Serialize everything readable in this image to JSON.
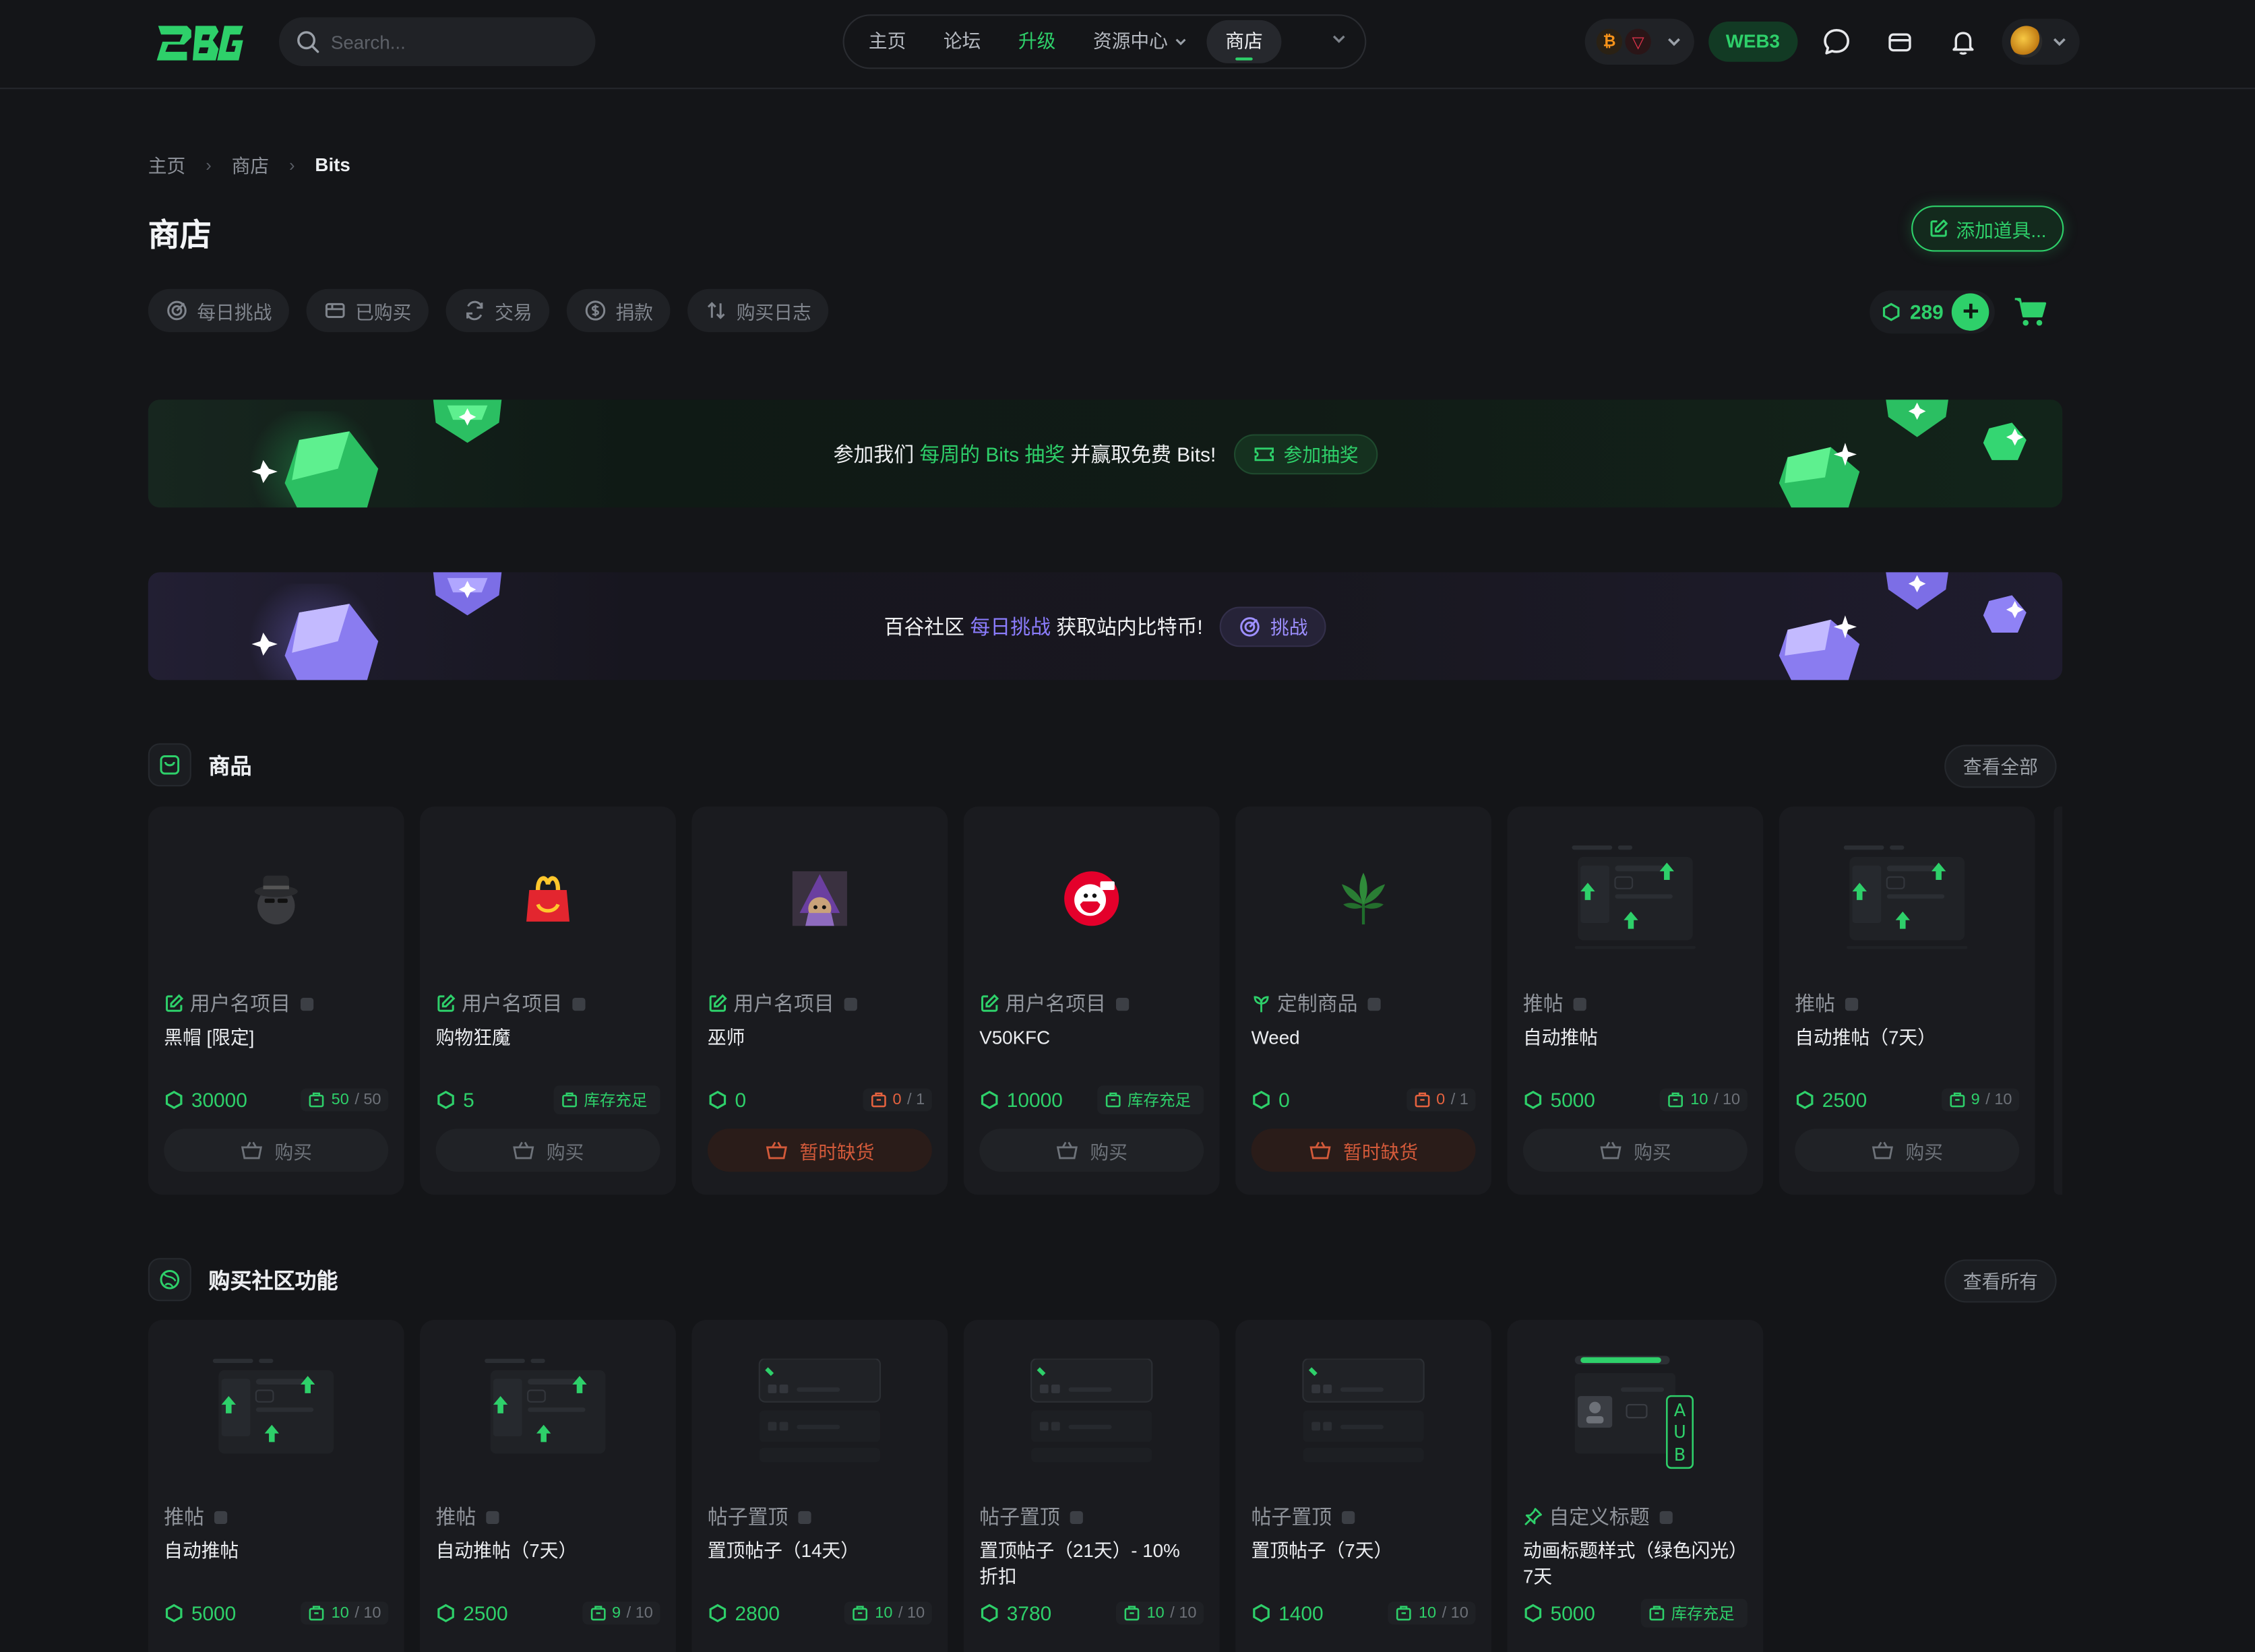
{
  "header": {
    "search_placeholder": "Search...",
    "nav": [
      "主页",
      "论坛",
      "升级",
      "资源中心",
      "商店"
    ],
    "web3_label": "WEB3"
  },
  "breadcrumb": {
    "home": "主页",
    "shop": "商店",
    "current": "Bits"
  },
  "page": {
    "title": "商店",
    "add_button": "添加道具...",
    "balance": "289"
  },
  "pills": [
    "每日挑战",
    "已购买",
    "交易",
    "捐款",
    "购买日志"
  ],
  "banners": {
    "raffle": {
      "pre": "参加我们",
      "highlight": "每周的 Bits 抽奖",
      "post": "并赢取免费 Bits!",
      "button": "参加抽奖"
    },
    "challenge": {
      "pre": "百谷社区",
      "highlight": "每日挑战",
      "post": "获取站内比特币!",
      "button": "挑战"
    }
  },
  "sections": {
    "goods": {
      "title": "商品",
      "view_all": "查看全部"
    },
    "features": {
      "title": "购买社区功能",
      "view_all": "查看所有"
    }
  },
  "goods": [
    {
      "category": "用户名项目",
      "name": "黑帽 [限定]",
      "price": "30000",
      "stock": "50",
      "stock_total": "/ 50",
      "action": "购买",
      "icon": "black-hat-icon"
    },
    {
      "category": "用户名项目",
      "name": "购物狂魔",
      "price": "5",
      "stock": "库存充足",
      "stock_total": "",
      "action": "购买",
      "icon": "happy-meal-icon"
    },
    {
      "category": "用户名项目",
      "name": "巫师",
      "price": "0",
      "stock": "0",
      "stock_total": "/ 1",
      "action": "暂时缺货",
      "icon": "wizard-icon"
    },
    {
      "category": "用户名项目",
      "name": "V50KFC",
      "price": "10000",
      "stock": "库存充足",
      "stock_total": "",
      "action": "购买",
      "icon": "kfc-icon"
    },
    {
      "category": "定制商品",
      "name": "Weed",
      "price": "0",
      "stock": "0",
      "stock_total": "/ 1",
      "action": "暂时缺货",
      "icon": "leaf-icon"
    },
    {
      "category": "推帖",
      "name": "自动推帖",
      "price": "5000",
      "stock": "10",
      "stock_total": "/ 10",
      "action": "购买",
      "icon": "bump-thread-icon"
    },
    {
      "category": "推帖",
      "name": "自动推帖（7天）",
      "price": "2500",
      "stock": "9",
      "stock_total": "/ 10",
      "action": "购买",
      "icon": "bump-thread-icon"
    }
  ],
  "features": [
    {
      "category": "推帖",
      "name": "自动推帖",
      "price": "5000",
      "stock": "10",
      "stock_total": "/ 10",
      "icon": "bump-thread-icon"
    },
    {
      "category": "推帖",
      "name": "自动推帖（7天）",
      "price": "2500",
      "stock": "9",
      "stock_total": "/ 10",
      "icon": "bump-thread-icon"
    },
    {
      "category": "帖子置顶",
      "name": "置顶帖子（14天）",
      "price": "2800",
      "stock": "10",
      "stock_total": "/ 10",
      "icon": "pin-thread-icon"
    },
    {
      "category": "帖子置顶",
      "name": "置顶帖子（21天）- 10% 折扣",
      "price": "3780",
      "stock": "10",
      "stock_total": "/ 10",
      "icon": "pin-thread-icon"
    },
    {
      "category": "帖子置顶",
      "name": "置顶帖子（7天）",
      "price": "1400",
      "stock": "10",
      "stock_total": "/ 10",
      "icon": "pin-thread-icon"
    },
    {
      "category": "自定义标题",
      "name": "动画标题样式（绿色闪光）7天",
      "price": "5000",
      "stock": "库存充足",
      "stock_total": "",
      "icon": "custom-title-icon"
    }
  ],
  "colors": {
    "accent": "#2ed06a",
    "danger": "#e5623f",
    "purple": "#8c7dff",
    "background": "#141518",
    "card": "#1a1b1f"
  }
}
